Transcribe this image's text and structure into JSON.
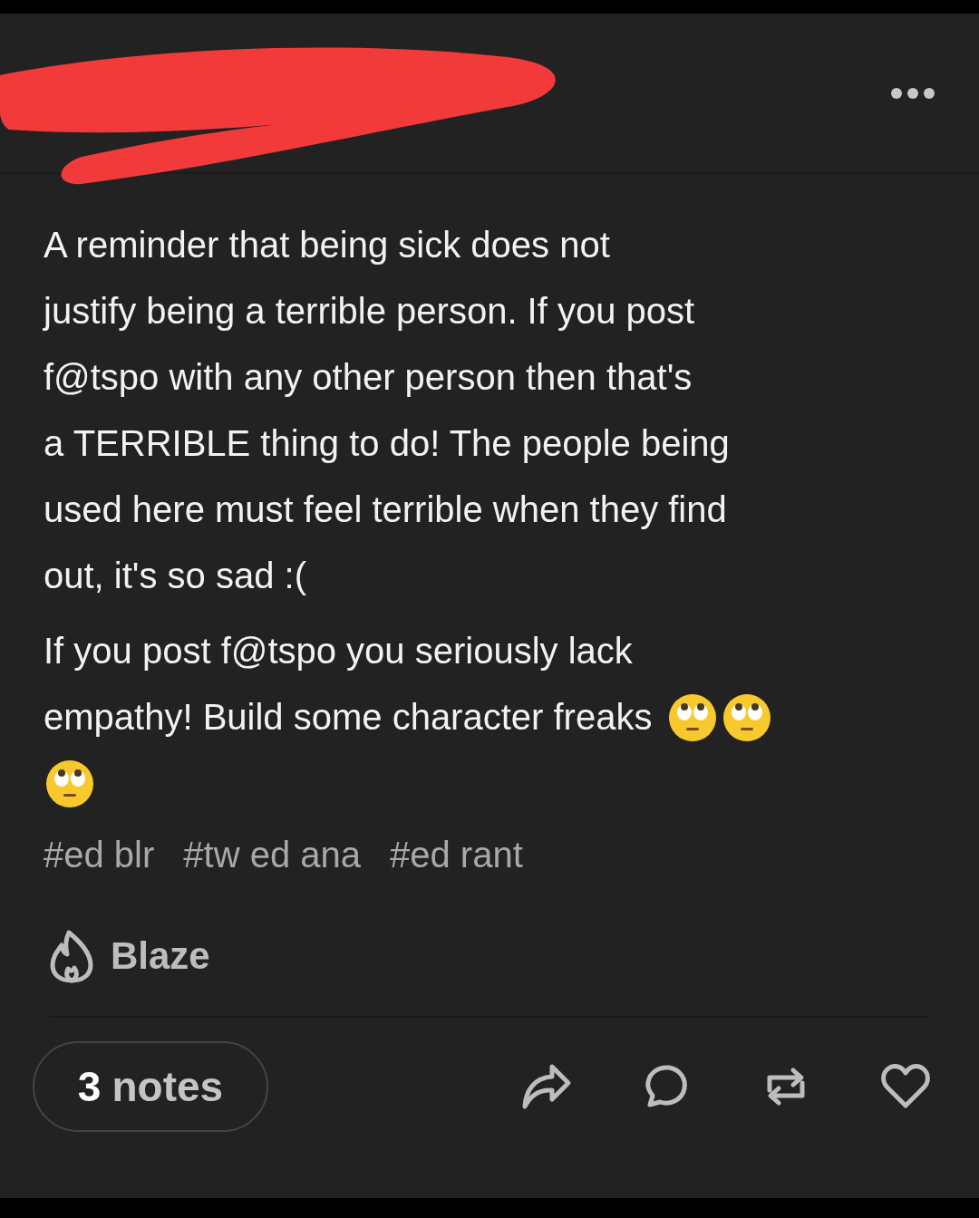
{
  "post": {
    "paragraphs": [
      [
        "A reminder that being sick does not",
        "justify being a terrible person. If you post",
        "f@tspo  with any other person then that's",
        "a TERRIBLE thing to do! The people being",
        "used here must feel terrible when they find",
        "out, it's so sad :("
      ],
      [
        "If you post f@tspo you seriously lack",
        "empathy! Build some character freaks"
      ]
    ],
    "tags": [
      "#ed blr",
      "#tw ed ana",
      "#ed rant"
    ],
    "blaze": "Blaze",
    "notes": {
      "count": "3",
      "label": "notes"
    }
  }
}
